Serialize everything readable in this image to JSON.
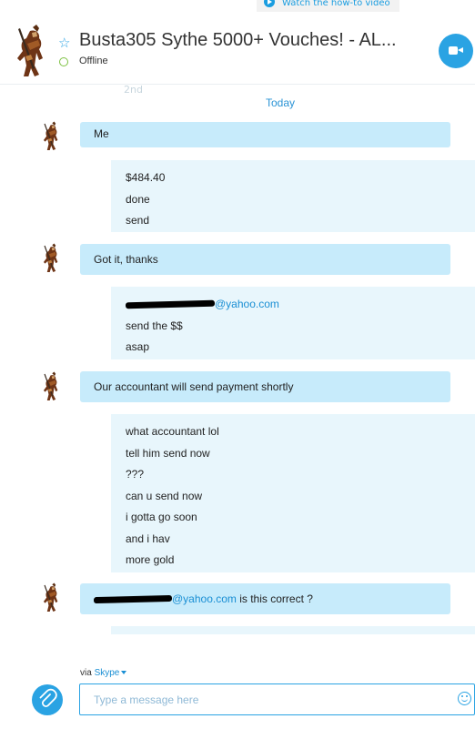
{
  "banner": {
    "howto_label": "Watch the how-to video"
  },
  "header": {
    "title": "Busta305 Sythe 5000+ Vouches! - AL...",
    "status": "Offline",
    "colors": {
      "accent": "#2aa3e3",
      "status": "#7dc142"
    }
  },
  "chat": {
    "faded_top": "2nd",
    "date_separator": "Today",
    "messages": [
      {
        "from": "them",
        "text": "Me"
      },
      {
        "from": "me",
        "lines": [
          "$484.40",
          "done",
          "send"
        ]
      },
      {
        "from": "them",
        "text": "Got it, thanks"
      },
      {
        "from": "me",
        "lines": [
          "@yahoo.com",
          "send the $$",
          "asap"
        ]
      },
      {
        "from": "them",
        "text": "Our accountant will send payment shortly"
      },
      {
        "from": "me",
        "lines": [
          "what accountant lol",
          "tell him send now",
          "???",
          "can u send now",
          "i gotta go soon",
          "and i hav",
          "more gold"
        ]
      },
      {
        "from": "them",
        "email_domain": "@yahoo.com",
        "text": " is this correct ?"
      }
    ]
  },
  "composer": {
    "via_label": "via",
    "via_service": "Skype",
    "placeholder": "Type a message here",
    "icons": {
      "attach": "attach-icon",
      "emoji": "emoji-icon",
      "video": "video-call-icon",
      "favorite": "star-icon"
    }
  }
}
